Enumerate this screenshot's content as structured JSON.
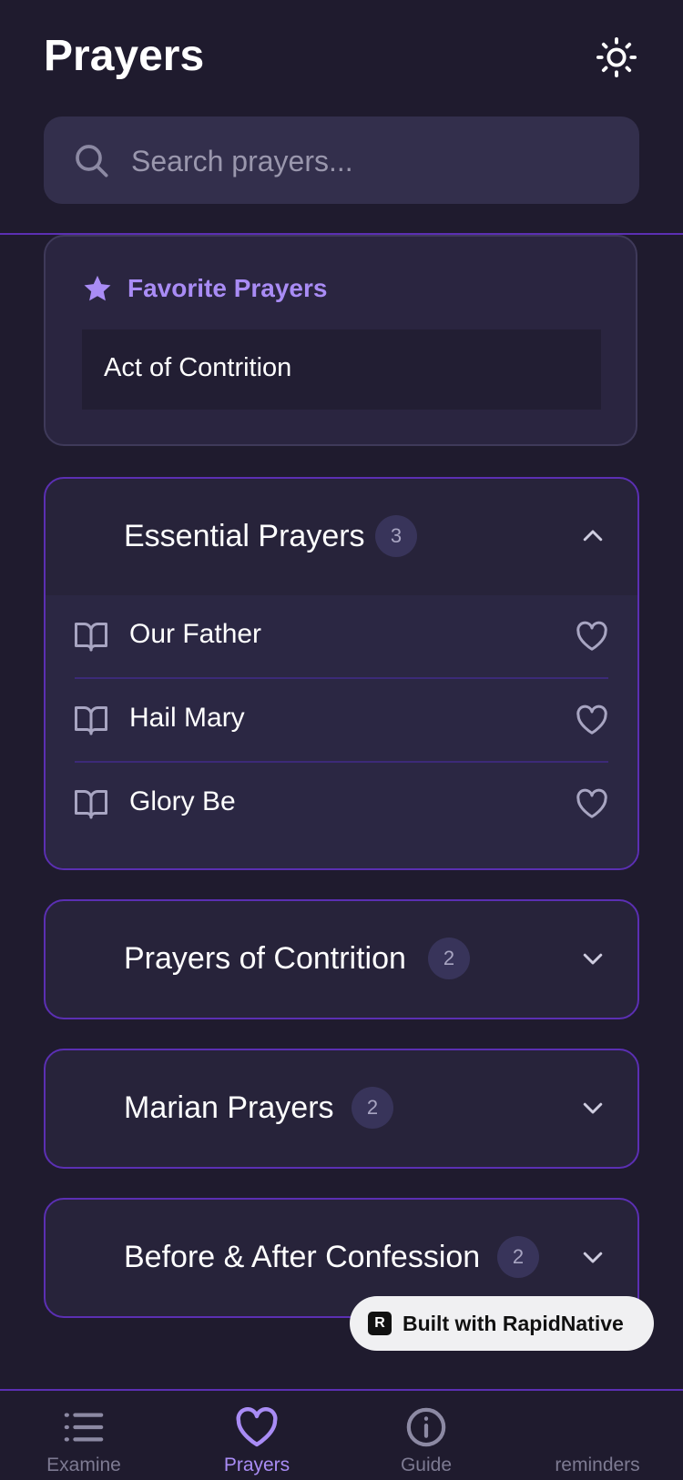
{
  "header": {
    "title": "Prayers",
    "theme_icon": "sun-icon"
  },
  "search": {
    "placeholder": "Search prayers..."
  },
  "favorites": {
    "title": "Favorite Prayers",
    "items": [
      "Act of Contrition"
    ]
  },
  "categories": [
    {
      "title": "Essential Prayers",
      "count": "3",
      "expanded": true,
      "prayers": [
        "Our Father",
        "Hail Mary",
        "Glory Be"
      ]
    },
    {
      "title": "Prayers of Contrition",
      "count": "2",
      "expanded": false
    },
    {
      "title": "Marian Prayers",
      "count": "2",
      "expanded": false
    },
    {
      "title": "Before & After Confession",
      "count": "2",
      "expanded": false
    }
  ],
  "badge_rapid": "Built with RapidNative",
  "tabs": [
    {
      "label": "Examine",
      "icon": "list-icon",
      "active": false
    },
    {
      "label": "Prayers",
      "icon": "heart-icon",
      "active": true
    },
    {
      "label": "Guide",
      "icon": "info-icon",
      "active": false
    },
    {
      "label": "reminders",
      "icon": "bell-icon",
      "active": false
    }
  ],
  "colors": {
    "accent": "#a98cf5",
    "border": "#5b2fb3",
    "background": "#1f1b2e",
    "card": "#27233a"
  }
}
